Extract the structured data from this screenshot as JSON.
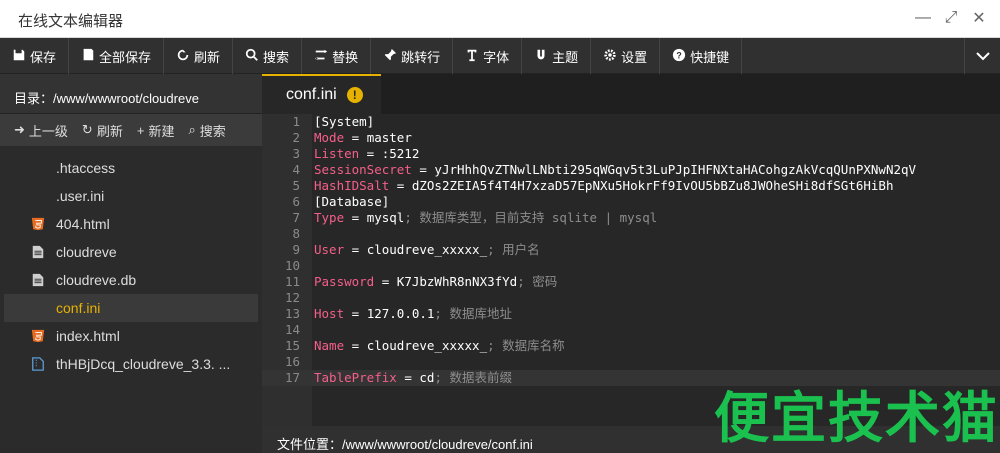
{
  "window": {
    "title": "在线文本编辑器"
  },
  "toolbar": [
    {
      "name": "save",
      "label": "保存",
      "icon": "save-icon"
    },
    {
      "name": "save-all",
      "label": "全部保存",
      "icon": "save-all-icon"
    },
    {
      "name": "refresh",
      "label": "刷新",
      "icon": "refresh-icon"
    },
    {
      "name": "search",
      "label": "搜索",
      "icon": "search-icon"
    },
    {
      "name": "replace",
      "label": "替换",
      "icon": "replace-icon"
    },
    {
      "name": "goto",
      "label": "跳转行",
      "icon": "pin-icon"
    },
    {
      "name": "font",
      "label": "字体",
      "icon": "font-icon"
    },
    {
      "name": "theme",
      "label": "主题",
      "icon": "theme-icon"
    },
    {
      "name": "settings",
      "label": "设置",
      "icon": "gear-icon"
    },
    {
      "name": "shortcuts",
      "label": "快捷键",
      "icon": "help-icon"
    }
  ],
  "sidebar": {
    "dir_label": "目录：/www/wwwroot/cloudreve",
    "tools": [
      "上一级",
      "刷新",
      "新建",
      "搜索"
    ],
    "files": [
      {
        "name": ".htaccess",
        "icon": "none",
        "active": false
      },
      {
        "name": ".user.ini",
        "icon": "none",
        "active": false
      },
      {
        "name": "404.html",
        "icon": "html5-icon",
        "active": false
      },
      {
        "name": "cloudreve",
        "icon": "document-icon",
        "active": false
      },
      {
        "name": "cloudreve.db",
        "icon": "document-icon",
        "active": false
      },
      {
        "name": "conf.ini",
        "icon": "none",
        "active": true
      },
      {
        "name": "index.html",
        "icon": "html5-icon",
        "active": false
      },
      {
        "name": "thHBjDcq_cloudreve_3.3.   ...",
        "icon": "archive-icon",
        "active": false
      }
    ]
  },
  "editor": {
    "tab": "conf.ini",
    "lines": [
      "[System]",
      "Mode = master",
      "Listen = :5212",
      "SessionSecret = yJrHhhQvZTNwlLNbti295qWGqv5t3LuPJpIHFNXtaHACohgzAkVcqQUnPXNwN2qV",
      "HashIDSalt = dZOs2ZEIA5f4T4H7xzaD57EpNXu5HokrFf9IvOU5bBZu8JWOheSHi8dfSGt6HiBh",
      "[Database]",
      "Type = mysql; 数据库类型，目前支持 sqlite | mysql",
      "",
      "User = cloudreve_xxxxx_; 用户名",
      "",
      "Password = K7JbzWhR8nNX3fYd; 密码",
      "",
      "Host = 127.0.0.1; 数据库地址",
      "",
      "Name = cloudreve_xxxxx_; 数据库名称",
      "",
      "TablePrefix = cd; 数据表前缀"
    ]
  },
  "status": {
    "label": "文件位置：/www/wwwroot/cloudreve/conf.ini"
  },
  "watermark": "便宜技术猫"
}
